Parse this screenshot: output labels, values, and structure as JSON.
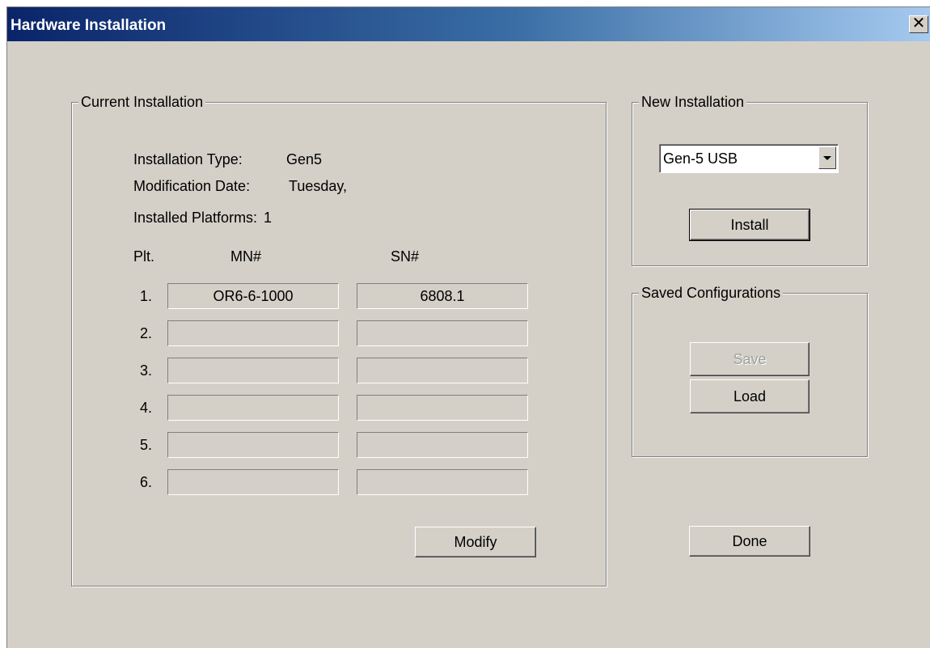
{
  "window": {
    "title": "Hardware Installation",
    "close_label": "✕"
  },
  "current": {
    "legend": "Current Installation",
    "type_label": "Installation Type:",
    "type_value": "Gen5",
    "date_label": "Modification Date:",
    "date_value": "Tuesday,",
    "platforms_label": "Installed Platforms:",
    "platforms_value": "1",
    "col_plt": "Plt.",
    "col_mn": "MN#",
    "col_sn": "SN#",
    "rows": [
      {
        "num": "1.",
        "mn": "OR6-6-1000",
        "sn": "6808.1"
      },
      {
        "num": "2.",
        "mn": "",
        "sn": ""
      },
      {
        "num": "3.",
        "mn": "",
        "sn": ""
      },
      {
        "num": "4.",
        "mn": "",
        "sn": ""
      },
      {
        "num": "5.",
        "mn": "",
        "sn": ""
      },
      {
        "num": "6.",
        "mn": "",
        "sn": ""
      }
    ],
    "modify_label": "Modify"
  },
  "new_install": {
    "legend": "New Installation",
    "selected": "Gen-5 USB",
    "install_label": "Install"
  },
  "saved": {
    "legend": "Saved Configurations",
    "save_label": "Save",
    "load_label": "Load"
  },
  "done_label": "Done"
}
